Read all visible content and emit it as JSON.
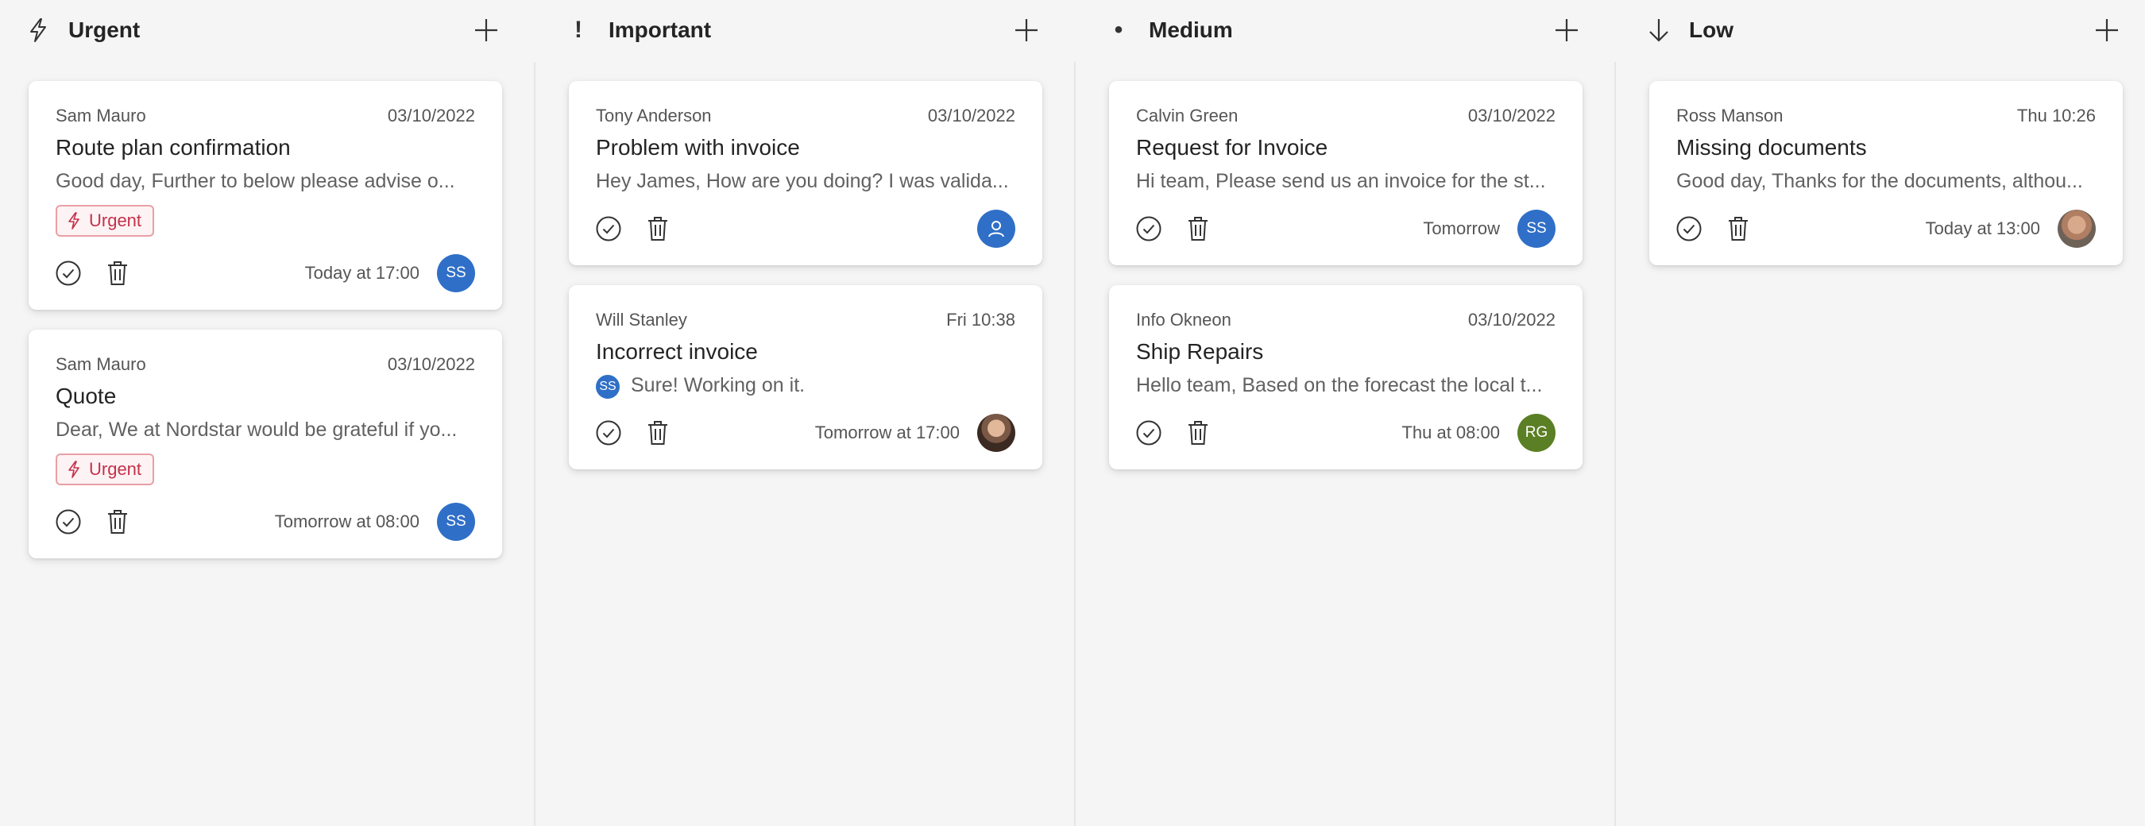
{
  "columns": [
    {
      "title": "Urgent",
      "icon": "lightning-icon",
      "cards": [
        {
          "sender": "Sam Mauro",
          "date": "03/10/2022",
          "subject": "Route plan confirmation",
          "preview": "Good day, Further to below please advise o...",
          "tag": "Urgent",
          "due": "Today at 17:00",
          "avatar": "SS",
          "avatar_color": "#2f6fc7"
        },
        {
          "sender": "Sam Mauro",
          "date": "03/10/2022",
          "subject": "Quote",
          "preview": "Dear, We at Nordstar would be grateful if yo...",
          "tag": "Urgent",
          "due": "Tomorrow at 08:00",
          "avatar": "SS",
          "avatar_color": "#2f6fc7"
        }
      ]
    },
    {
      "title": "Important",
      "icon": "exclamation-icon",
      "icon_glyph": "!",
      "cards": [
        {
          "sender": "Tony Anderson",
          "date": "03/10/2022",
          "subject": "Problem with invoice",
          "preview": "Hey James, How are you doing? I was valida...",
          "due": "",
          "avatar_color": "#2f6fc7"
        },
        {
          "sender": "Will Stanley",
          "date": "Fri 10:38",
          "subject": "Incorrect invoice",
          "preview_avatar": "SS",
          "preview": "Sure! Working on it.",
          "due": "Tomorrow at 17:00"
        }
      ]
    },
    {
      "title": "Medium",
      "icon": "bullet-icon",
      "icon_glyph": "•",
      "cards": [
        {
          "sender": "Calvin Green",
          "date": "03/10/2022",
          "subject": "Request for Invoice",
          "preview": "Hi team, Please send us an invoice for the st...",
          "due": "Tomorrow",
          "avatar": "SS",
          "avatar_color": "#2f6fc7"
        },
        {
          "sender": "Info Okneon",
          "date": "03/10/2022",
          "subject": "Ship Repairs",
          "preview": "Hello team, Based on the forecast the local t...",
          "due": "Thu at 08:00",
          "avatar": "RG",
          "avatar_color": "#5b7f24"
        }
      ]
    },
    {
      "title": "Low",
      "icon": "arrow-down-icon",
      "cards": [
        {
          "sender": "Ross Manson",
          "date": "Thu 10:26",
          "subject": "Missing documents",
          "preview": "Good day, Thanks for the documents, althou...",
          "due": "Today at 13:00"
        }
      ]
    }
  ],
  "colors": {
    "background": "#f5f5f5",
    "card": "#ffffff",
    "tag_text": "#c4314b",
    "tag_border": "#e8a0a5",
    "avatar_blue": "#2f6fc7",
    "avatar_green": "#5b7f24"
  }
}
